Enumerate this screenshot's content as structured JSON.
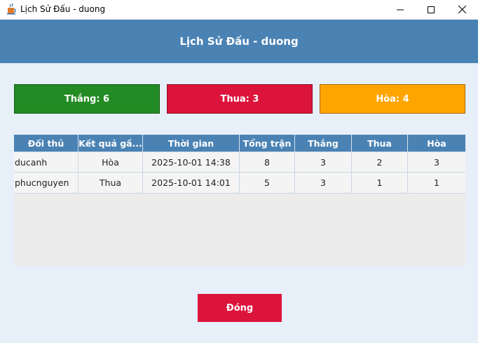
{
  "window": {
    "title": "Lịch Sử Đấu - duong"
  },
  "header": {
    "title": "Lịch Sử Đấu - duong"
  },
  "stats": {
    "win_label": "Thắng: 6",
    "lose_label": "Thua: 3",
    "draw_label": "Hòa: 4"
  },
  "table": {
    "columns": [
      "Đối thủ",
      "Kết quả gầ...",
      "Thời gian",
      "Tổng trận",
      "Thắng",
      "Thua",
      "Hòa"
    ],
    "rows": [
      [
        "ducanh",
        "Hòa",
        "2025-10-01 14:38",
        "8",
        "3",
        "2",
        "3"
      ],
      [
        "phucnguyen",
        "Thua",
        "2025-10-01 14:01",
        "5",
        "3",
        "1",
        "1"
      ]
    ]
  },
  "footer": {
    "close_label": "Đóng"
  },
  "colors": {
    "header_bg": "#4a82b4",
    "win": "#238b23",
    "lose": "#dc143c",
    "draw": "#ffa500",
    "close_button": "#dc143c",
    "window_bg": "#e7eff9"
  },
  "icons": {
    "app": "java-cup-icon",
    "minimize": "minimize-icon",
    "maximize": "maximize-icon",
    "close": "close-icon"
  }
}
